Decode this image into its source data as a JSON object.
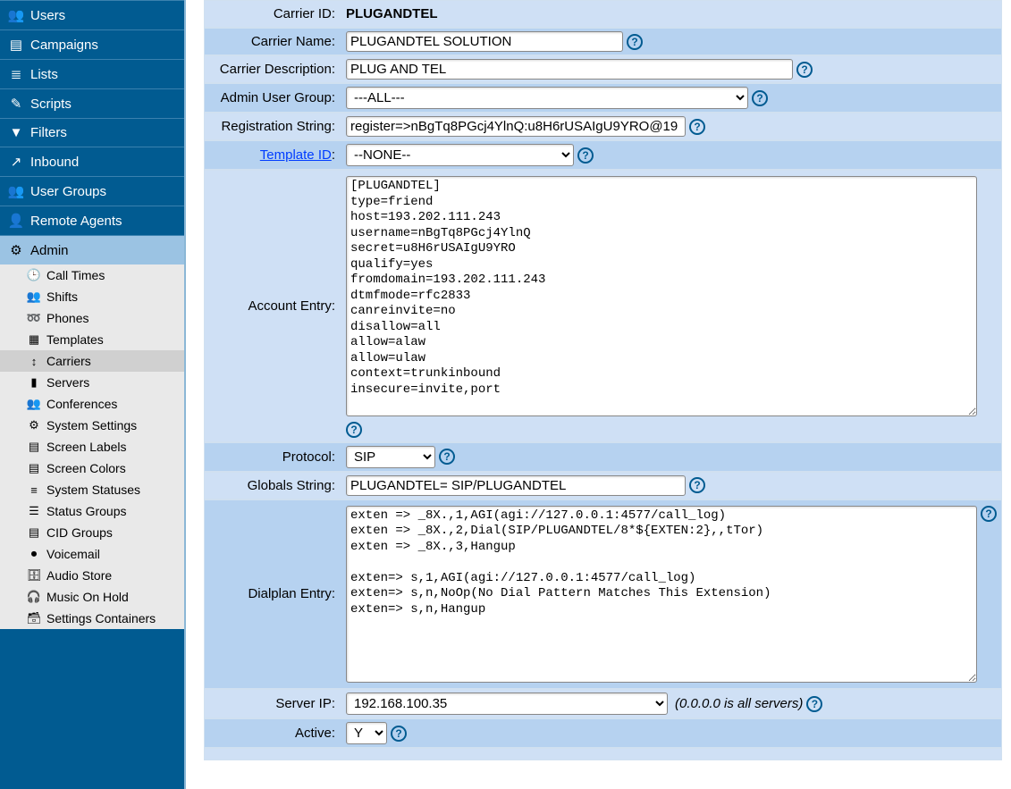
{
  "sidebar": {
    "items": [
      {
        "label": "Users",
        "icon": "👥"
      },
      {
        "label": "Campaigns",
        "icon": "▤"
      },
      {
        "label": "Lists",
        "icon": "≣"
      },
      {
        "label": "Scripts",
        "icon": "✎"
      },
      {
        "label": "Filters",
        "icon": "▼"
      },
      {
        "label": "Inbound",
        "icon": "↗"
      },
      {
        "label": "User Groups",
        "icon": "👥"
      },
      {
        "label": "Remote Agents",
        "icon": "👤"
      }
    ],
    "admin": {
      "label": "Admin",
      "icon": "⚙"
    },
    "subs": [
      {
        "label": "Call Times",
        "icon": "🕒"
      },
      {
        "label": "Shifts",
        "icon": "👥"
      },
      {
        "label": "Phones",
        "icon": "➿"
      },
      {
        "label": "Templates",
        "icon": "▦"
      },
      {
        "label": "Carriers",
        "icon": "↕"
      },
      {
        "label": "Servers",
        "icon": "▮"
      },
      {
        "label": "Conferences",
        "icon": "👥"
      },
      {
        "label": "System Settings",
        "icon": "⚙"
      },
      {
        "label": "Screen Labels",
        "icon": "▤"
      },
      {
        "label": "Screen Colors",
        "icon": "▤"
      },
      {
        "label": "System Statuses",
        "icon": "≡"
      },
      {
        "label": "Status Groups",
        "icon": "☰"
      },
      {
        "label": "CID Groups",
        "icon": "▤"
      },
      {
        "label": "Voicemail",
        "icon": "⏺"
      },
      {
        "label": "Audio Store",
        "icon": "🗄"
      },
      {
        "label": "Music On Hold",
        "icon": "🎧"
      },
      {
        "label": "Settings Containers",
        "icon": "🗃"
      }
    ]
  },
  "form": {
    "labels": {
      "carrier_id": "Carrier ID:",
      "carrier_name": "Carrier Name:",
      "carrier_desc": "Carrier Description:",
      "admin_group": "Admin User Group:",
      "reg_string": "Registration String:",
      "template_id": "Template ID",
      "account_entry": "Account Entry:",
      "protocol": "Protocol:",
      "globals": "Globals String:",
      "dialplan": "Dialplan Entry:",
      "server_ip": "Server IP:",
      "active": "Active:"
    },
    "carrier_id": "PLUGANDTEL",
    "carrier_name": "PLUGANDTEL SOLUTION",
    "carrier_desc": "PLUG AND TEL",
    "admin_group": "---ALL---",
    "reg_string": "register=>nBgTq8PGcj4YlnQ:u8H6rUSAIgU9YRO@19",
    "template_id": "--NONE--",
    "account_entry": "[PLUGANDTEL]\ntype=friend\nhost=193.202.111.243\nusername=nBgTq8PGcj4YlnQ\nsecret=u8H6rUSAIgU9YRO\nqualify=yes\nfromdomain=193.202.111.243\ndtmfmode=rfc2833\ncanreinvite=no\ndisallow=all\nallow=alaw\nallow=ulaw\ncontext=trunkinbound\ninsecure=invite,port",
    "protocol": "SIP",
    "globals": "PLUGANDTEL= SIP/PLUGANDTEL",
    "dialplan": "exten => _8X.,1,AGI(agi://127.0.0.1:4577/call_log)\nexten => _8X.,2,Dial(SIP/PLUGANDTEL/8*${EXTEN:2},,tTor)\nexten => _8X.,3,Hangup\n\nexten=> s,1,AGI(agi://127.0.0.1:4577/call_log)\nexten=> s,n,NoOp(No Dial Pattern Matches This Extension)\nexten=> s,n,Hangup",
    "server_ip": "192.168.100.35",
    "server_note": "(0.0.0.0 is all servers)",
    "active": "Y"
  }
}
